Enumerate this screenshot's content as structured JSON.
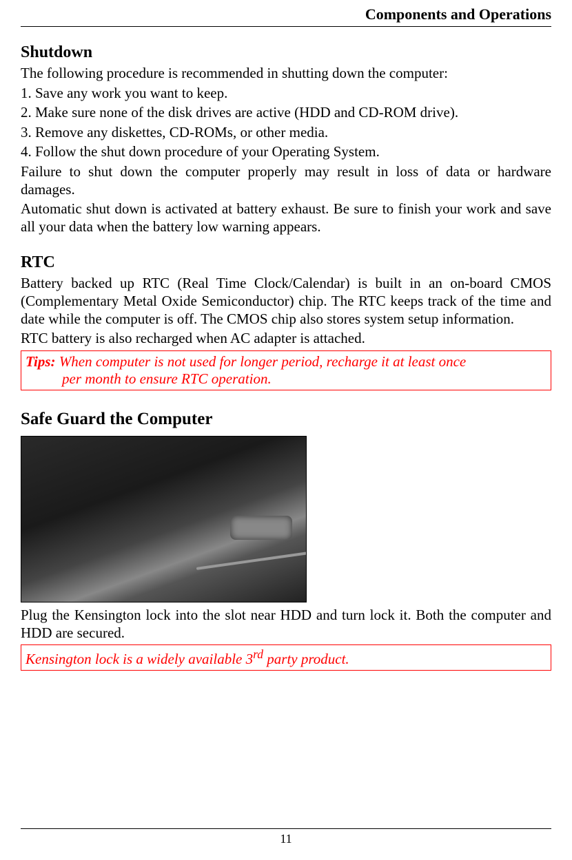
{
  "header": {
    "title": "Components and Operations"
  },
  "shutdown": {
    "heading": "Shutdown",
    "intro": "The following procedure is recommended in shutting down the computer:",
    "steps": [
      "1. Save any work you want to keep.",
      "2. Make sure none of the disk drives are active (HDD and CD-ROM drive).",
      "3. Remove any diskettes, CD-ROMs, or other media.",
      "4. Follow the shut down procedure of your Operating System."
    ],
    "warn1": "Failure to shut down the computer properly may result in loss of data or hardware damages.",
    "warn2": "Automatic shut down is activated at battery exhaust. Be sure to finish your work and save all your data when the battery low warning appears."
  },
  "rtc": {
    "heading": "RTC",
    "p1": "Battery backed up RTC (Real Time Clock/Calendar) is built in an on-board CMOS (Complementary Metal Oxide Semiconductor) chip. The RTC keeps track of the time and date while the computer is off. The CMOS chip also stores system setup information.",
    "p2": "RTC battery is also recharged when AC adapter is attached.",
    "tips_label": "Tips:",
    "tips_line1": " When computer is not used for longer period, recharge it at least once",
    "tips_line2": "per month to ensure RTC operation."
  },
  "safeguard": {
    "heading": "Safe Guard the Computer",
    "p1": "Plug the Kensington lock into the slot near HDD and turn lock it. Both the computer and HDD are secured.",
    "note_prefix": "Kensington lock is a widely available 3",
    "note_sup": "rd",
    "note_suffix": " party product."
  },
  "footer": {
    "page_number": "11"
  }
}
